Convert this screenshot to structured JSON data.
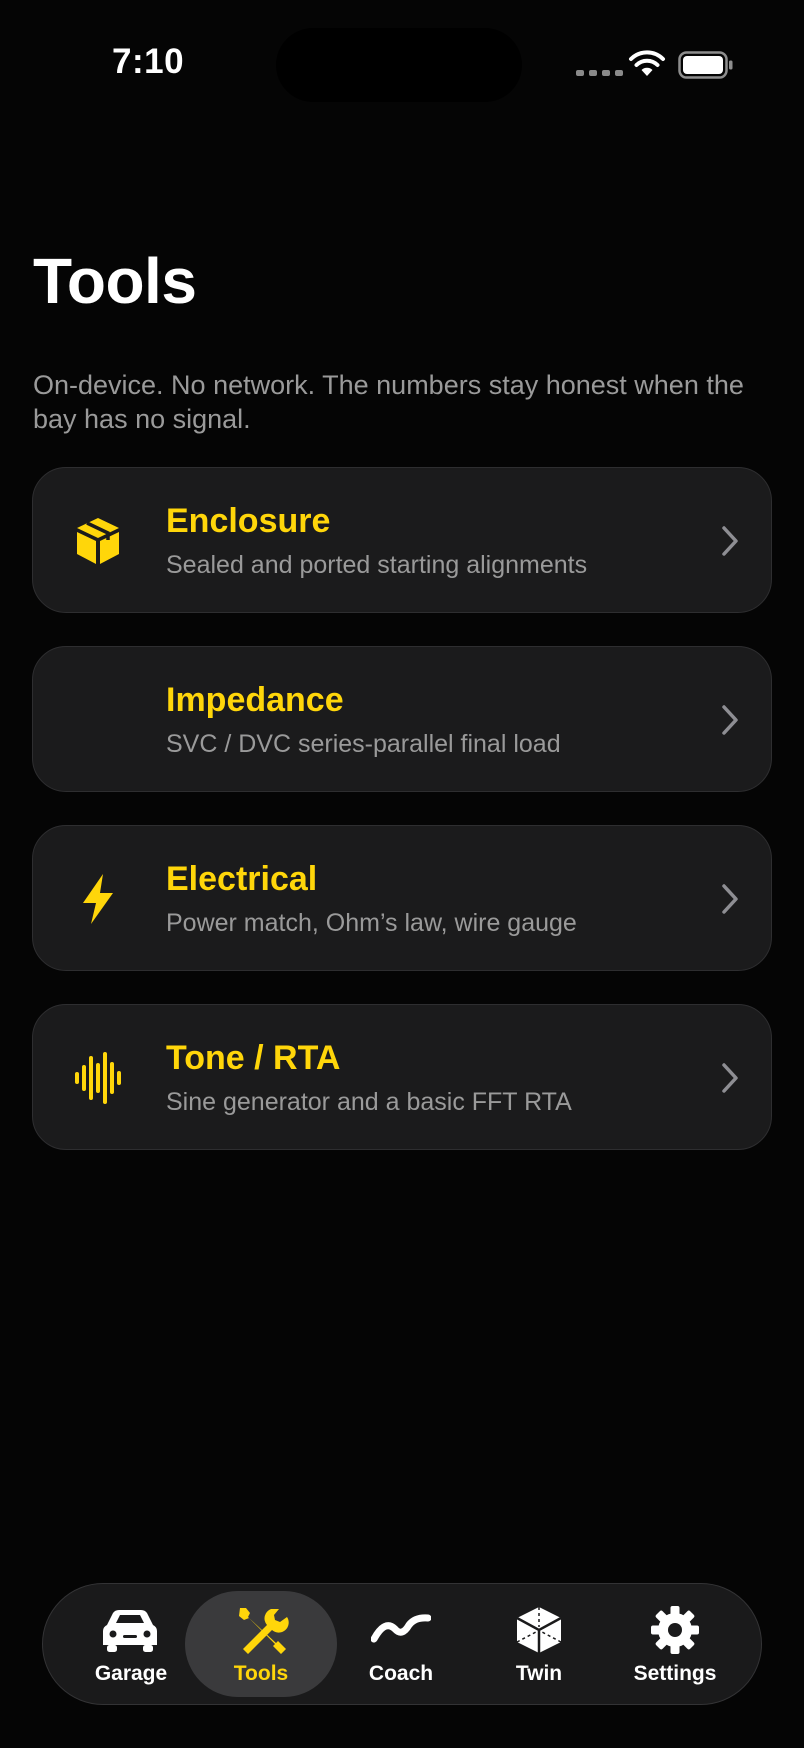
{
  "status_bar": {
    "time": "7:10"
  },
  "header": {
    "title": "Tools",
    "subtitle": "On-device. No network. The numbers stay honest when the bay has no signal."
  },
  "tools": [
    {
      "title": "Enclosure",
      "description": "Sealed and ported starting alignments",
      "icon": "box-icon"
    },
    {
      "title": "Impedance",
      "description": "SVC / DVC series-parallel final load",
      "icon": "none"
    },
    {
      "title": "Electrical",
      "description": "Power match, Ohm’s law, wire gauge",
      "icon": "bolt-icon"
    },
    {
      "title": "Tone / RTA",
      "description": "Sine generator and a basic FFT RTA",
      "icon": "waveform-icon"
    }
  ],
  "tab_bar": {
    "active": "Tools",
    "items": [
      {
        "label": "Garage",
        "icon": "car-icon"
      },
      {
        "label": "Tools",
        "icon": "wrench-screwdriver-icon"
      },
      {
        "label": "Coach",
        "icon": "signature-wave-icon"
      },
      {
        "label": "Twin",
        "icon": "cube-icon"
      },
      {
        "label": "Settings",
        "icon": "gear-icon"
      }
    ]
  },
  "colors": {
    "background": "#050505",
    "card": "#1b1b1c",
    "accent": "#ffd60a",
    "secondary_text": "#9a9a9a"
  }
}
